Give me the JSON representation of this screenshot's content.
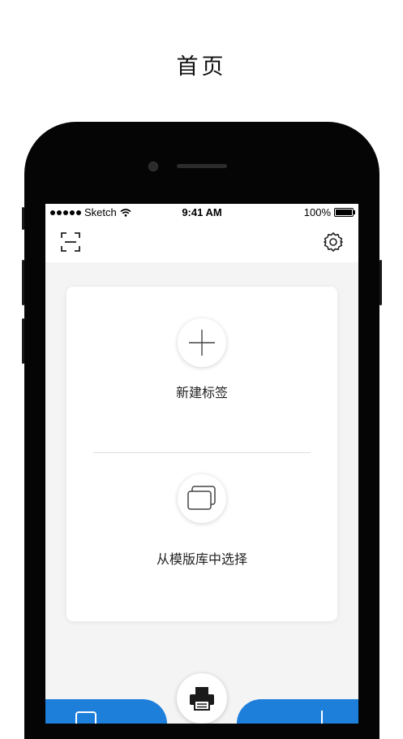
{
  "page": {
    "title": "首页"
  },
  "status_bar": {
    "carrier": "Sketch",
    "time": "9:41 AM",
    "battery": "100%"
  },
  "card": {
    "new_label": "新建标签",
    "template_label": "从模版库中选择"
  },
  "icons": {
    "scan": "scan-icon",
    "settings": "gear-icon",
    "add": "plus-icon",
    "templates": "stacked-pages-icon",
    "print": "printer-icon"
  },
  "colors": {
    "accent": "#1e7fdb"
  }
}
